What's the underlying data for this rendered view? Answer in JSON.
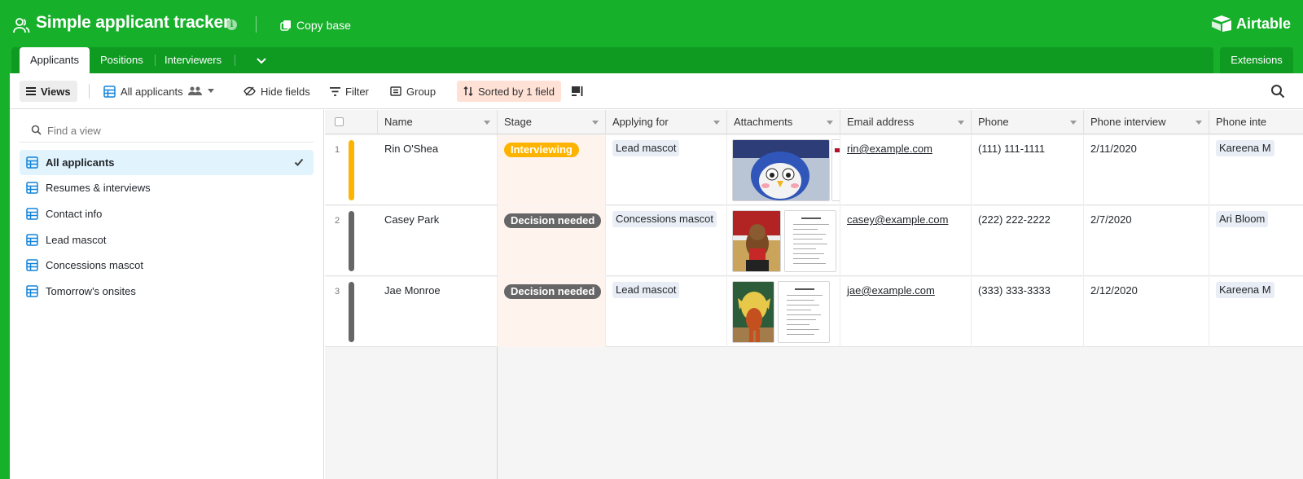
{
  "header": {
    "base_title": "Simple applicant tracker",
    "copy_base_label": "Copy base",
    "brand_name": "Airtable",
    "accent_color": "#17b02b"
  },
  "tabs": [
    {
      "label": "Applicants",
      "active": true
    },
    {
      "label": "Positions",
      "active": false
    },
    {
      "label": "Interviewers",
      "active": false
    }
  ],
  "extensions_label": "Extensions",
  "toolbar": {
    "views_label": "Views",
    "current_view": "All applicants",
    "hide_fields": "Hide fields",
    "filter": "Filter",
    "group": "Group",
    "sorted": "Sorted by 1 field"
  },
  "sidebar": {
    "find_placeholder": "Find a view",
    "views": [
      {
        "label": "All applicants",
        "active": true
      },
      {
        "label": "Resumes & interviews",
        "active": false
      },
      {
        "label": "Contact info",
        "active": false
      },
      {
        "label": "Lead mascot",
        "active": false
      },
      {
        "label": "Concessions mascot",
        "active": false
      },
      {
        "label": "Tomorrow's onsites",
        "active": false
      }
    ]
  },
  "table": {
    "columns": [
      "Name",
      "Stage",
      "Applying for",
      "Attachments",
      "Email address",
      "Phone",
      "Phone interview",
      "Phone inte"
    ],
    "rows": [
      {
        "num": "1",
        "name": "Rin O'Shea",
        "stage": "Interviewing",
        "stage_color": "#fcb400",
        "applying_for": "Lead mascot",
        "email": "rin@example.com",
        "phone": "(111) 111-1111",
        "phone_interview": "2/11/2020",
        "interviewer": "Kareena M"
      },
      {
        "num": "2",
        "name": "Casey Park",
        "stage": "Decision needed",
        "stage_color": "#666666",
        "applying_for": "Concessions mascot",
        "email": "casey@example.com",
        "phone": "(222) 222-2222",
        "phone_interview": "2/7/2020",
        "interviewer": "Ari Bloom"
      },
      {
        "num": "3",
        "name": "Jae Monroe",
        "stage": "Decision needed",
        "stage_color": "#666666",
        "applying_for": "Lead mascot",
        "email": "jae@example.com",
        "phone": "(333) 333-3333",
        "phone_interview": "2/12/2020",
        "interviewer": "Kareena M"
      }
    ]
  }
}
